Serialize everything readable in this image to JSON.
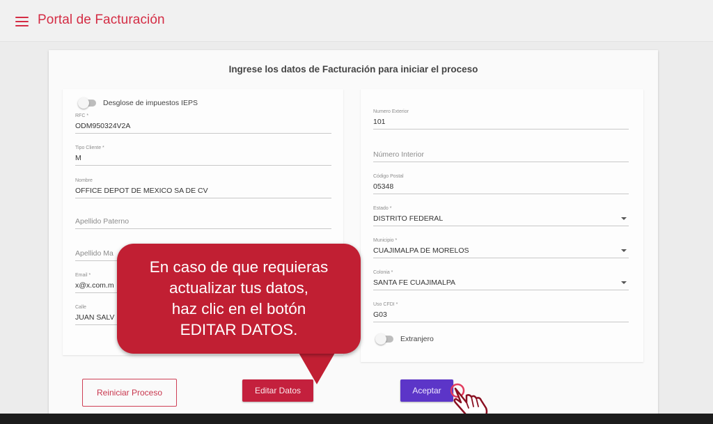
{
  "appbar": {
    "title": "Portal de Facturación",
    "menu_icon": "hamburger-menu-icon"
  },
  "form": {
    "title": "Ingrese los datos de Facturación para iniciar el proceso",
    "left": {
      "ieps_toggle_label": "Desglose de impuestos IEPS",
      "rfc": {
        "label": "RFC *",
        "value": "ODM950324V2A"
      },
      "tipo_cliente": {
        "label": "Tipo Cliente *",
        "value": "M"
      },
      "nombre": {
        "label": "Nombre",
        "value": "OFFICE DEPOT DE MEXICO SA DE CV"
      },
      "apellido_paterno": {
        "placeholder": "Apellido Paterno"
      },
      "apellido_materno": {
        "placeholder": "Apellido Ma"
      },
      "email": {
        "label": "Email *",
        "value": "x@x.com.m"
      },
      "calle": {
        "label": "Calle",
        "value": "JUAN SALV"
      }
    },
    "right": {
      "numero_exterior": {
        "label": "Numero Exterior",
        "value": "101"
      },
      "numero_interior": {
        "placeholder": "Número Interior"
      },
      "codigo_postal": {
        "label": "Código Postal",
        "value": "05348"
      },
      "estado": {
        "label": "Estado *",
        "value": "DISTRITO FEDERAL"
      },
      "municipio": {
        "label": "Municipio *",
        "value": "CUAJIMALPA DE MORELOS"
      },
      "colonia": {
        "label": "Colonia *",
        "value": "SANTA FE CUAJIMALPA"
      },
      "uso_cfdi": {
        "label": "Uso CFDI *",
        "value": "G03"
      },
      "extranjero_toggle_label": "Extranjero"
    }
  },
  "buttons": {
    "reiniciar": "Reiniciar Proceso",
    "editar": "Editar Datos",
    "aceptar": "Aceptar"
  },
  "callout": {
    "lines": [
      "En caso de que requieras",
      "actualizar tus datos,",
      "haz clic en el botón",
      "EDITAR DATOS."
    ]
  },
  "colors": {
    "brand": "#d42c44",
    "callout": "#c11f33",
    "editar_button": "#c4203d",
    "aceptar_button": "#5c35c8"
  },
  "icons": {
    "cursor": "hand-pointer-icon",
    "dropdown": "caret-down-icon"
  }
}
